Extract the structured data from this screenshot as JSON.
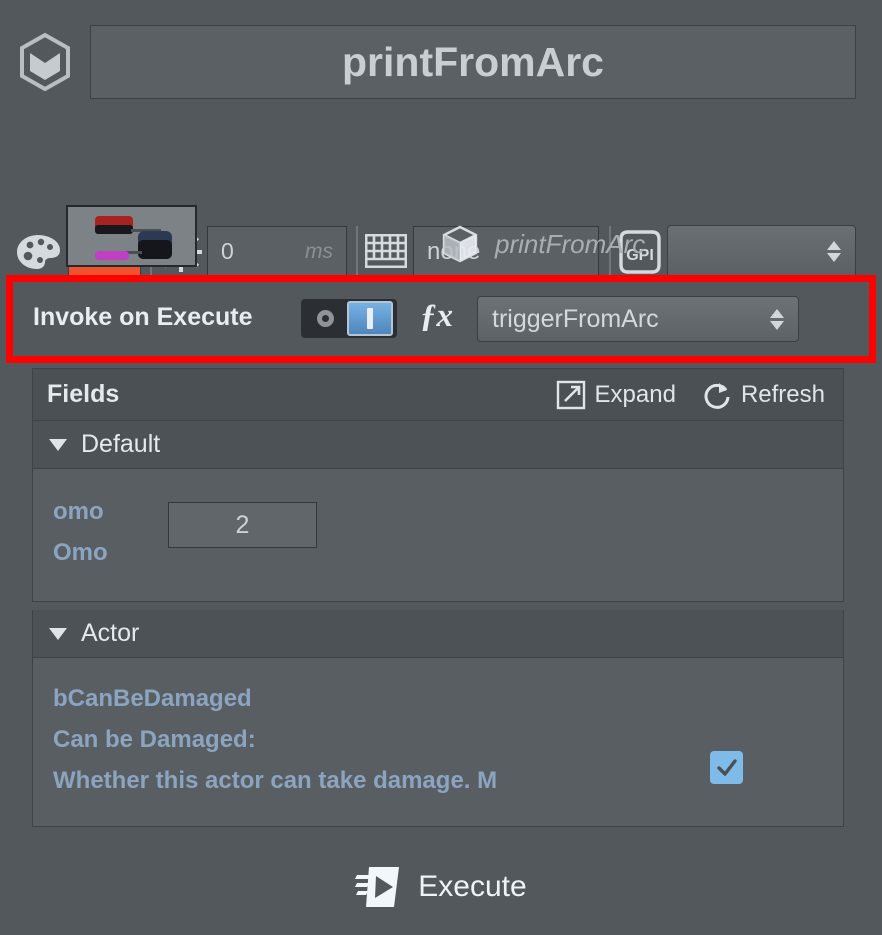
{
  "header": {
    "logo_icon": "hexagon-cube-icon",
    "title": "printFromArc"
  },
  "toolbar": {
    "palette_icon": "palette-icon",
    "color_swatch": "#f0512f",
    "clock_icon": "clock-icon",
    "delay_value": "0",
    "delay_unit": "ms",
    "keyboard_icon": "keyboard-icon",
    "key_binding": "none",
    "gpi_icon": "gpi-icon",
    "gpi_value": "",
    "spinner_icon": "spinner-updown-icon"
  },
  "node": {
    "thumbnail": "blueprint-graph-thumbnail",
    "cube_icon": "cube-icon",
    "name": "printFromArc"
  },
  "invoke": {
    "label": "Invoke on Execute",
    "toggle_off_label": "O",
    "toggle_on_label": "I",
    "toggle_state": "on",
    "fx_icon": "fx-icon",
    "function": "triggerFromArc",
    "highlight_color": "#fe0000"
  },
  "fields": {
    "title": "Fields",
    "expand_label": "Expand",
    "expand_icon": "expand-arrow-icon",
    "refresh_label": "Refresh",
    "refresh_icon": "refresh-circular-arrow-icon",
    "sections": [
      {
        "title": "Default",
        "expanded": true,
        "caret_icon": "caret-down-icon",
        "properties": [
          {
            "var_name": "omo",
            "display_name": "Omo",
            "type": "number",
            "value": "2"
          }
        ]
      },
      {
        "title": "Actor",
        "expanded": true,
        "caret_icon": "caret-down-icon",
        "properties": [
          {
            "var_name": "bCanBeDamaged",
            "display_name": "Can be Damaged:",
            "description": "Whether this actor can take damage. M",
            "type": "checkbox",
            "checked": true
          }
        ]
      }
    ]
  },
  "footer": {
    "execute_label": "Execute",
    "execute_icon": "execute-play-icon"
  }
}
